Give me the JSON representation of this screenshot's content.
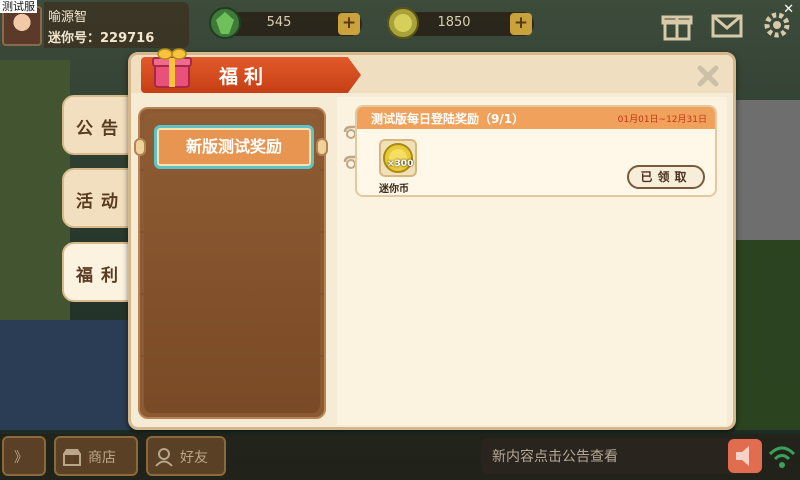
{
  "window": {
    "title": "测试服",
    "close_glyph": "✕"
  },
  "user": {
    "name": "喻源智",
    "id_label": "迷你号：229716"
  },
  "resources": [
    {
      "icon": "gem-icon",
      "value": "545",
      "plus": "+"
    },
    {
      "icon": "coin-icon",
      "value": "1850",
      "plus": "+"
    }
  ],
  "side_tabs": [
    {
      "label": "公告"
    },
    {
      "label": "活动"
    },
    {
      "label": "福利",
      "active": true
    }
  ],
  "modal": {
    "title": "福利",
    "nav": [
      {
        "label": "新版测试奖励",
        "selected": true
      }
    ],
    "reward": {
      "title": "测试版每日登陆奖励（9/1）",
      "date_range": "01月01日~12月31日",
      "item_label": "迷你币",
      "item_count": "×300",
      "claim_label": "已领取"
    }
  },
  "bottom": {
    "expand_glyph": "》",
    "shop_label": "商店",
    "friends_label": "好友",
    "announce_text": "新内容点击公告查看"
  },
  "colors": {
    "ribbon": "#d24a1e",
    "nav_selected": "#e89551",
    "nav_border": "#5ec2c8",
    "card_header": "#f0a25c"
  }
}
